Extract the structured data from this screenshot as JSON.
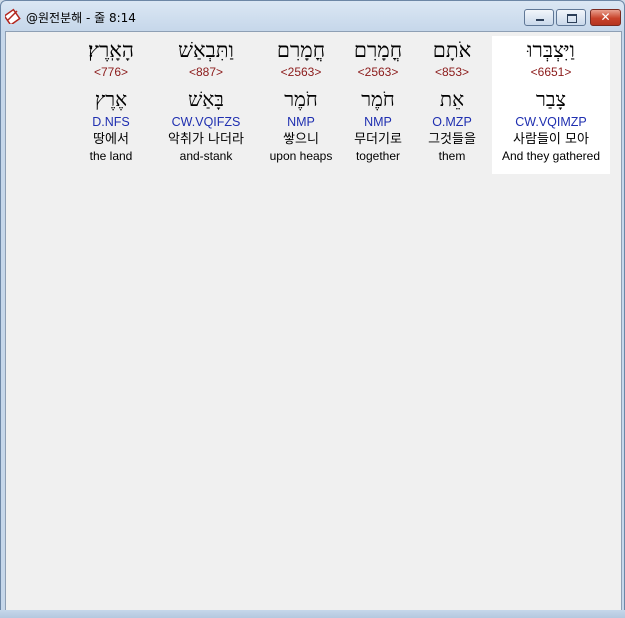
{
  "window": {
    "title": "@원전분해 - 줄 8:14",
    "close_glyph": "✕"
  },
  "words": [
    {
      "hebrew": "הָאָֽרֶץ׃",
      "strong": "<776>",
      "lemma": "אֶרֶץ",
      "parse": "D.NFS",
      "korean": "땅에서",
      "english": "the land"
    },
    {
      "hebrew": "וַתִּבְאַשׁ",
      "strong": "<887>",
      "lemma": "בָּאַשׁ",
      "parse": "CW.VQIFZS",
      "korean": "악취가 나더라",
      "english": "and-stank"
    },
    {
      "hebrew": "חֳמָרִם",
      "strong": "<2563>",
      "lemma": "חֹמֶר",
      "parse": "NMP",
      "korean": "쌓으니",
      "english": "upon heaps"
    },
    {
      "hebrew": "חֳמָרִם",
      "strong": "<2563>",
      "lemma": "חֹמֶר",
      "parse": "NMP",
      "korean": "무더기로",
      "english": "together"
    },
    {
      "hebrew": "אֹתָם",
      "strong": "<853>",
      "lemma": "אֵת",
      "parse": "O.MZP",
      "korean": "그것들을",
      "english": "them"
    },
    {
      "hebrew": "וַיִּצְבְּרוּ",
      "strong": "<6651>",
      "lemma": "צָבַר",
      "parse": "CW.VQIMZP",
      "korean": "사람들이 모아",
      "english": "And they gathered"
    }
  ]
}
